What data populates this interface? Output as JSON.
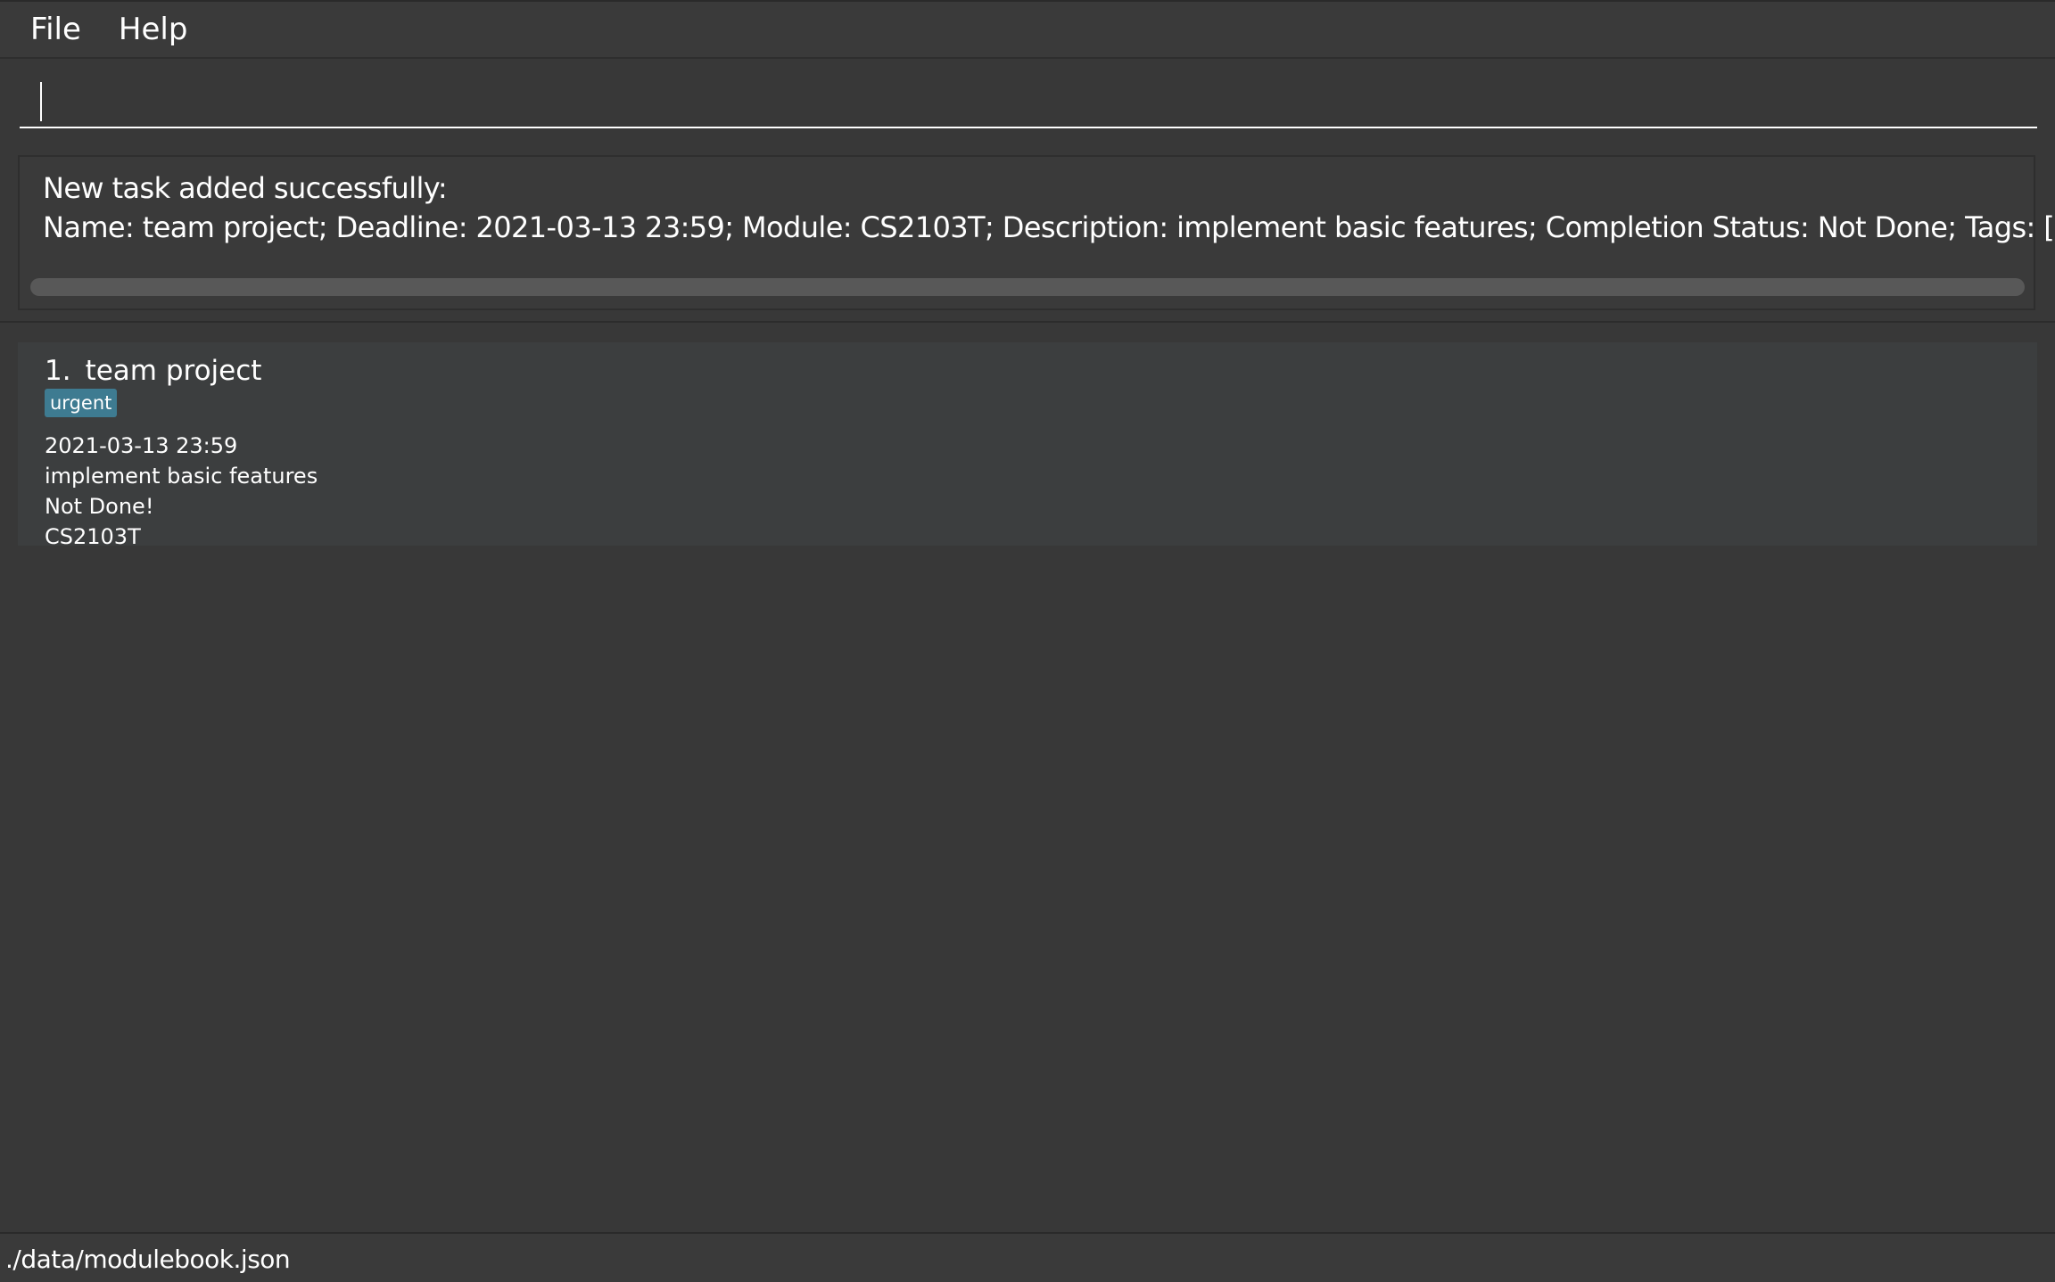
{
  "menu": {
    "items": [
      {
        "label": "File"
      },
      {
        "label": "Help"
      }
    ]
  },
  "command_box": {
    "value": "",
    "placeholder": ""
  },
  "result_display": {
    "line1": "New task added successfully:",
    "line2": "Name: team project; Deadline: 2021-03-13 23:59; Module: CS2103T; Description: implement basic features; Completion Status: Not Done; Tags: [urgent]"
  },
  "task_list": [
    {
      "index": "1.",
      "name": "team project",
      "tags": [
        "urgent"
      ],
      "deadline": "2021-03-13 23:59",
      "description": "implement basic features",
      "status": "Not Done!",
      "module": "CS2103T"
    }
  ],
  "status_bar": {
    "path": "./data/modulebook.json"
  },
  "colors": {
    "background": "#383838",
    "card": "#3c3e3f",
    "tag": "#3e7b91",
    "text": "#ffffff"
  }
}
